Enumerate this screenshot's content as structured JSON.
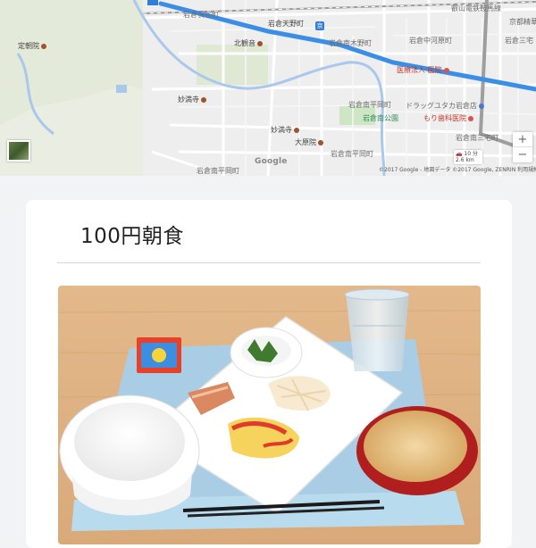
{
  "map": {
    "labels": [
      {
        "id": "label-top-left-1",
        "text": "岩倉天野町",
        "cls": "dark"
      },
      {
        "id": "label-top-right-1",
        "text": "岩倉中河原町",
        "cls": ""
      },
      {
        "id": "label-top-right-2",
        "text": "岩倉三宅",
        "cls": ""
      },
      {
        "id": "label-station-name",
        "text": "岩倉南木野町",
        "cls": ""
      },
      {
        "id": "label-hachiman",
        "text": "岩倉長谷町",
        "cls": ""
      },
      {
        "id": "label-line-name",
        "text": "叡山電鉄鞍馬線",
        "cls": ""
      },
      {
        "id": "label-kitakura",
        "text": "北観音",
        "cls": "dark"
      },
      {
        "id": "label-clinic",
        "text": "医療法人 医院",
        "cls": "red"
      },
      {
        "id": "label-temple-left",
        "text": "定朝院",
        "cls": "dark"
      },
      {
        "id": "label-shrine",
        "text": "妙満寺",
        "cls": "dark"
      },
      {
        "id": "label-drugstore",
        "text": "ドラッグユタカ岩倉店",
        "cls": ""
      },
      {
        "id": "label-park",
        "text": "岩倉南公園",
        "cls": "green"
      },
      {
        "id": "label-hospital",
        "text": "もり歯科医院",
        "cls": "red"
      },
      {
        "id": "label-iwakura-1",
        "text": "岩倉南平岡町",
        "cls": ""
      },
      {
        "id": "label-temple-2",
        "text": "妙満寺",
        "cls": "dark"
      },
      {
        "id": "label-daikakuji",
        "text": "大原院",
        "cls": "dark"
      },
      {
        "id": "label-iwakura-2",
        "text": "岩倉南平岡町",
        "cls": ""
      },
      {
        "id": "label-iwakura-3",
        "text": "岩倉南平岡町",
        "cls": ""
      },
      {
        "id": "label-iwakura-4",
        "text": "岩倉南三宅町",
        "cls": ""
      },
      {
        "id": "label-kyodo",
        "text": "京都精華大学",
        "cls": ""
      }
    ],
    "google": "Google",
    "copyright": "©2017 Google - 地図データ ©2017 Google, ZENRIN   利用規約",
    "zoom_in": "+",
    "zoom_out": "−",
    "route_time": "10 分",
    "route_dist": "2.6 km",
    "station_icon": "京"
  },
  "card": {
    "title": "100円朝食"
  },
  "photo": {
    "alt": "breakfast tray"
  }
}
